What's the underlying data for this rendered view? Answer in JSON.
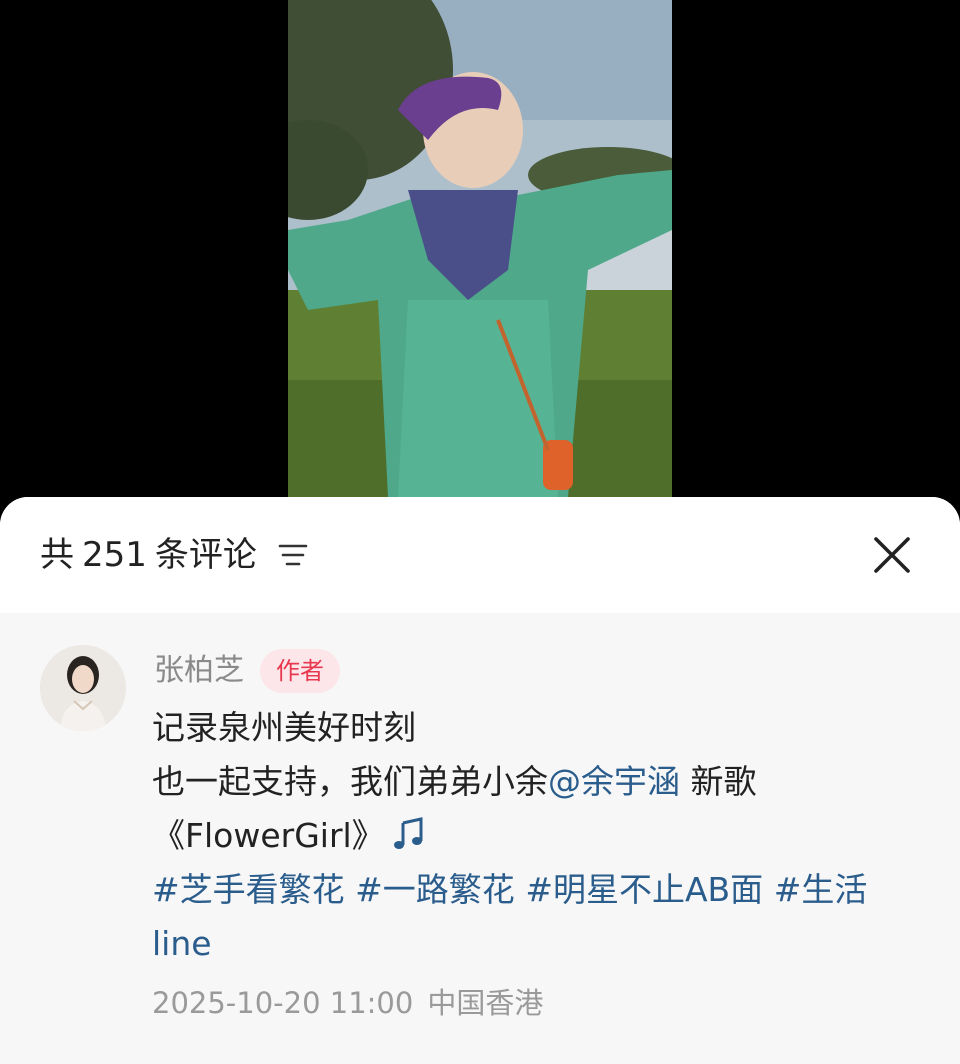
{
  "header": {
    "count_prefix": "共",
    "count_value": "251",
    "count_suffix": "条评论"
  },
  "comments": [
    {
      "author": "张柏芝",
      "badge": "作者",
      "line1": "记录泉州美好时刻",
      "line2_pre": "也一起支持，我们弟弟小余",
      "mention": "@余宇涵",
      "line2_post": " 新歌",
      "line3": "《FlowerGirl》",
      "tags": [
        "#芝手看繁花",
        "#一路繁花",
        "#明星不止AB面",
        "#生活"
      ],
      "tag_tail": "line",
      "date": "2025-10-20 11:00",
      "location": "中国香港"
    }
  ],
  "icons": {
    "sort": "sort-lines-icon",
    "close": "close-icon",
    "music": "music-note-icon"
  },
  "colors": {
    "link": "#2b5d8c",
    "badge_text": "#e8384f",
    "badge_bg": "#fde6e9"
  }
}
